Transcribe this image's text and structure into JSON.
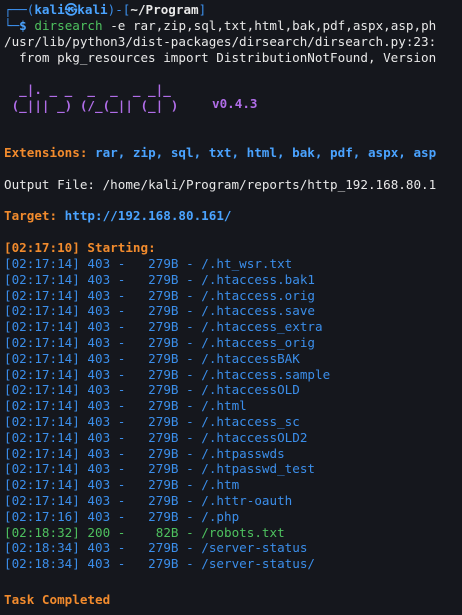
{
  "terminal": {
    "prompt": {
      "line1_prefix": "┌──(",
      "user": "kali",
      "at": "㉿",
      "host": "kali",
      "sep": ")-[",
      "cwd": "~/Program",
      "close": "]",
      "line2_prefix": "└─",
      "dollar": "$",
      "command": "dirsearch",
      "args": "-e rar,zip,sql,txt,html,bak,pdf,aspx,asp,ph"
    },
    "warning": {
      "line1": "/usr/lib/python3/dist-packages/dirsearch/dirsearch.py:23:",
      "line2": "  from pkg_resources import DistributionNotFound, Version"
    },
    "banner": {
      "row1": "  _|. _ _  _  _  _ _|_",
      "row2": " (_||| _) (/_(_|| (_| )",
      "version": "v0.4.3"
    },
    "extensions": {
      "label": "Extensions:",
      "value": "rar, zip, sql, txt, html, bak, pdf, aspx, asp"
    },
    "output_file": {
      "label": "Output File:",
      "value": "/home/kali/Program/reports/http_192.168.80.1"
    },
    "target": {
      "label": "Target:",
      "value": "http://192.168.80.161/"
    },
    "starting": {
      "time": "[02:17:10]",
      "label": "Starting:"
    },
    "results": [
      {
        "time": "[02:17:14]",
        "status": "403",
        "size": "279B",
        "path": "/.ht_wsr.txt",
        "ok": false
      },
      {
        "time": "[02:17:14]",
        "status": "403",
        "size": "279B",
        "path": "/.htaccess.bak1",
        "ok": false
      },
      {
        "time": "[02:17:14]",
        "status": "403",
        "size": "279B",
        "path": "/.htaccess.orig",
        "ok": false
      },
      {
        "time": "[02:17:14]",
        "status": "403",
        "size": "279B",
        "path": "/.htaccess.save",
        "ok": false
      },
      {
        "time": "[02:17:14]",
        "status": "403",
        "size": "279B",
        "path": "/.htaccess_extra",
        "ok": false
      },
      {
        "time": "[02:17:14]",
        "status": "403",
        "size": "279B",
        "path": "/.htaccess_orig",
        "ok": false
      },
      {
        "time": "[02:17:14]",
        "status": "403",
        "size": "279B",
        "path": "/.htaccessBAK",
        "ok": false
      },
      {
        "time": "[02:17:14]",
        "status": "403",
        "size": "279B",
        "path": "/.htaccess.sample",
        "ok": false
      },
      {
        "time": "[02:17:14]",
        "status": "403",
        "size": "279B",
        "path": "/.htaccessOLD",
        "ok": false
      },
      {
        "time": "[02:17:14]",
        "status": "403",
        "size": "279B",
        "path": "/.html",
        "ok": false
      },
      {
        "time": "[02:17:14]",
        "status": "403",
        "size": "279B",
        "path": "/.htaccess_sc",
        "ok": false
      },
      {
        "time": "[02:17:14]",
        "status": "403",
        "size": "279B",
        "path": "/.htaccessOLD2",
        "ok": false
      },
      {
        "time": "[02:17:14]",
        "status": "403",
        "size": "279B",
        "path": "/.htpasswds",
        "ok": false
      },
      {
        "time": "[02:17:14]",
        "status": "403",
        "size": "279B",
        "path": "/.htpasswd_test",
        "ok": false
      },
      {
        "time": "[02:17:14]",
        "status": "403",
        "size": "279B",
        "path": "/.htm",
        "ok": false
      },
      {
        "time": "[02:17:14]",
        "status": "403",
        "size": "279B",
        "path": "/.httr-oauth",
        "ok": false
      },
      {
        "time": "[02:17:16]",
        "status": "403",
        "size": "279B",
        "path": "/.php",
        "ok": false
      },
      {
        "time": "[02:18:32]",
        "status": "200",
        "size": "82B",
        "path": "/robots.txt",
        "ok": true
      },
      {
        "time": "[02:18:34]",
        "status": "403",
        "size": "279B",
        "path": "/server-status",
        "ok": false
      },
      {
        "time": "[02:18:34]",
        "status": "403",
        "size": "279B",
        "path": "/server-status/",
        "ok": false
      }
    ],
    "completed": "Task Completed"
  },
  "colors": {
    "background": "#15171d",
    "prompt_blue": "#3b8eea",
    "orange": "#f28b2d",
    "green": "#4ec15f",
    "banner_purple": "#b06de8"
  }
}
